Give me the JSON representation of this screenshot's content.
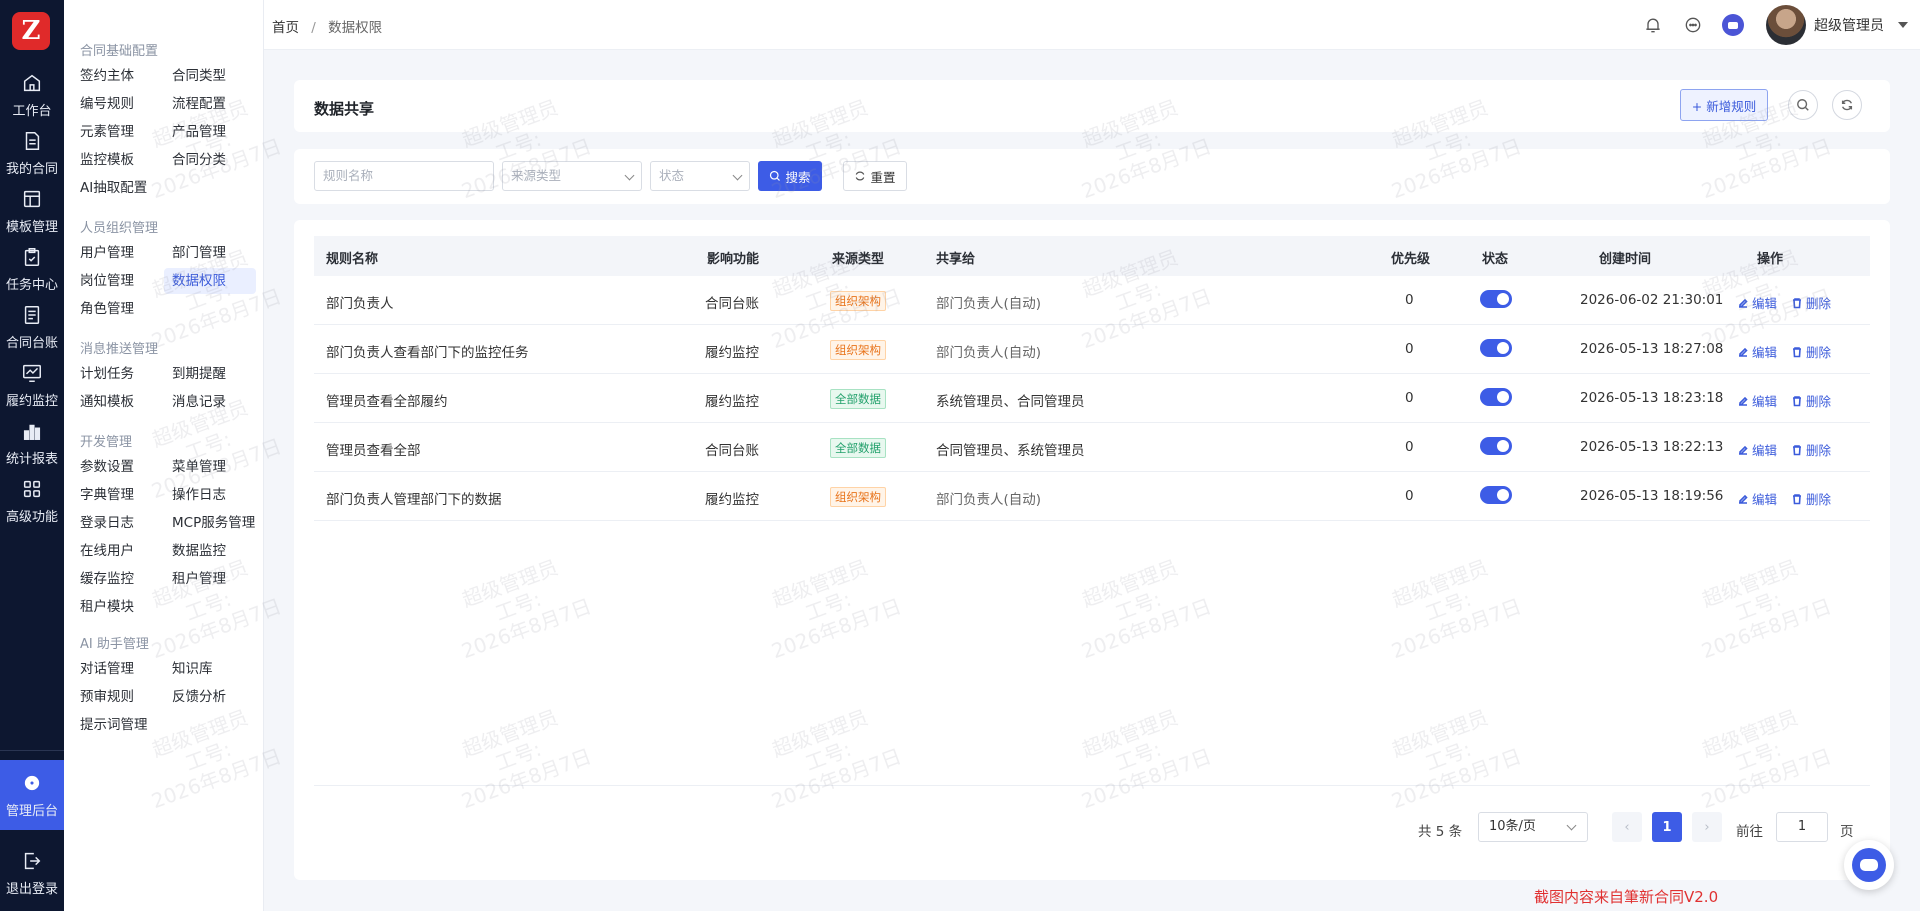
{
  "app": {
    "logo_letter": "Z"
  },
  "rail": {
    "items": [
      {
        "label": "工作台",
        "icon": "home-icon"
      },
      {
        "label": "我的合同",
        "icon": "document-icon"
      },
      {
        "label": "模板管理",
        "icon": "template-icon"
      },
      {
        "label": "任务中心",
        "icon": "clipboard-icon"
      },
      {
        "label": "合同台账",
        "icon": "ledger-icon"
      },
      {
        "label": "履约监控",
        "icon": "monitor-icon"
      },
      {
        "label": "统计报表",
        "icon": "bar-chart-icon"
      },
      {
        "label": "高级功能",
        "icon": "grid-icon"
      }
    ],
    "admin": {
      "label": "管理后台",
      "icon": "gear-icon"
    },
    "logout": {
      "label": "退出登录",
      "icon": "logout-icon"
    }
  },
  "submenu": {
    "groups": [
      {
        "title": "合同基础配置",
        "items": [
          "签约主体",
          "合同类型",
          "编号规则",
          "流程配置",
          "元素管理",
          "产品管理",
          "监控模板",
          "合同分类",
          "AI抽取配置"
        ]
      },
      {
        "title": "人员组织管理",
        "items": [
          "用户管理",
          "部门管理",
          "岗位管理",
          "数据权限",
          "角色管理"
        ]
      },
      {
        "title": "消息推送管理",
        "items": [
          "计划任务",
          "到期提醒",
          "通知模板",
          "消息记录"
        ]
      },
      {
        "title": "开发管理",
        "items": [
          "参数设置",
          "菜单管理",
          "字典管理",
          "操作日志",
          "登录日志",
          "MCP服务管理",
          "在线用户",
          "数据监控",
          "缓存监控",
          "租户管理",
          "租户模块"
        ]
      },
      {
        "title": "AI 助手管理",
        "items": [
          "对话管理",
          "知识库",
          "预审规则",
          "反馈分析",
          "提示词管理"
        ]
      }
    ],
    "active": "数据权限"
  },
  "topbar": {
    "breadcrumb": {
      "home": "首页",
      "sep": "/",
      "current": "数据权限"
    },
    "user_name": "超级管理员"
  },
  "header": {
    "title": "数据共享",
    "add_button": "+ 新增规则"
  },
  "filters": {
    "rule_name_placeholder": "规则名称",
    "source_type_placeholder": "来源类型",
    "status_placeholder": "状态",
    "search_label": "搜索",
    "reset_label": "重置"
  },
  "table": {
    "columns": [
      "规则名称",
      "影响功能",
      "来源类型",
      "共享给",
      "优先级",
      "状态",
      "创建时间",
      "操作"
    ],
    "rows": [
      {
        "name": "部门负责人",
        "feature": "合同台账",
        "source": "组织架构",
        "source_kind": "org",
        "share": "部门负责人(自动)",
        "priority": "0",
        "enabled": true,
        "created": "2026-06-02 21:30:01"
      },
      {
        "name": "部门负责人查看部门下的监控任务",
        "feature": "履约监控",
        "source": "组织架构",
        "source_kind": "org",
        "share": "部门负责人(自动)",
        "priority": "0",
        "enabled": true,
        "created": "2026-05-13 18:27:08"
      },
      {
        "name": "管理员查看全部履约",
        "feature": "履约监控",
        "source": "全部数据",
        "source_kind": "all",
        "share": "系统管理员、合同管理员",
        "priority": "0",
        "enabled": true,
        "created": "2026-05-13 18:23:18"
      },
      {
        "name": "管理员查看全部",
        "feature": "合同台账",
        "source": "全部数据",
        "source_kind": "all",
        "share": "合同管理员、系统管理员",
        "priority": "0",
        "enabled": true,
        "created": "2026-05-13 18:22:13"
      },
      {
        "name": "部门负责人管理部门下的数据",
        "feature": "履约监控",
        "source": "组织架构",
        "source_kind": "org",
        "share": "部门负责人(自动)",
        "priority": "0",
        "enabled": true,
        "created": "2026-05-13 18:19:56"
      }
    ],
    "edit_label": "编辑",
    "delete_label": "删除"
  },
  "pagination": {
    "total": "共 5 条",
    "page_size": "10条/页",
    "current_page": "1",
    "goto_label": "前往",
    "goto_value": "1",
    "page_unit": "页"
  },
  "watermark": {
    "line1": "超级管理员",
    "line2": "工号:",
    "line3": "2026年8月7日"
  },
  "footer_note": "截图内容来自筆新合同V2.0",
  "colors": {
    "primary": "#3d5ce6",
    "rail_bg": "#0d1730",
    "org_tag": "#e8731a",
    "all_tag": "#22a06b",
    "note_red": "#e03131"
  }
}
